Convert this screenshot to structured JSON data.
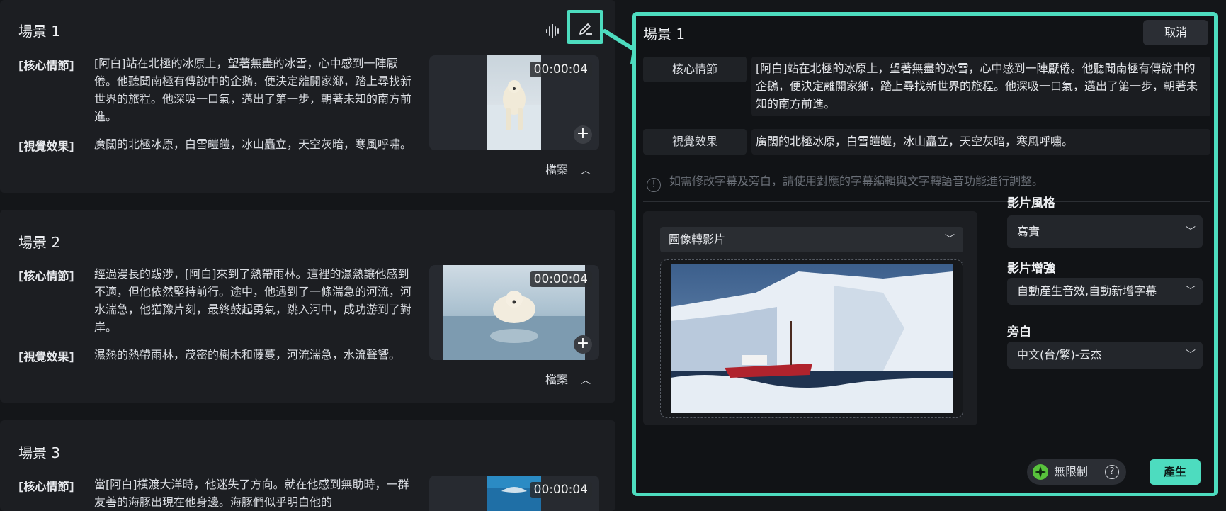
{
  "scenes": [
    {
      "title": "場景 1",
      "core_label": "[核心情節]",
      "core_text": "[阿白]站在北極的冰原上，望著無盡的冰雪，心中感到一陣厭倦。他聽聞南極有傳說中的企鵝，便決定離開家鄉，踏上尋找新世界的旅程。他深吸一口氣，邁出了第一步，朝著未知的南方前進。",
      "visual_label": "[視覺效果]",
      "visual_text": "廣闊的北極冰原，白雪皚皚，冰山矗立，天空灰暗，寒風呼嘯。",
      "timestamp": "00:00:04",
      "file_label": "檔案"
    },
    {
      "title": "場景 2",
      "core_label": "[核心情節]",
      "core_text": "經過漫長的跋涉，[阿白]來到了熱帶雨林。這裡的濕熱讓他感到不適，但他依然堅持前行。途中，他遇到了一條湍急的河流，河水湍急，他猶豫片刻，最終鼓起勇氣，跳入河中，成功游到了對岸。",
      "visual_label": "[視覺效果]",
      "visual_text": "濕熱的熱帶雨林，茂密的樹木和藤蔓，河流湍急，水流聲響。",
      "timestamp": "00:00:04",
      "file_label": "檔案"
    },
    {
      "title": "場景 3",
      "core_label": "[核心情節]",
      "core_text": "當[阿白]橫渡大洋時，他迷失了方向。就在他感到無助時，一群友善的海豚出現在他身邊。海豚們似乎明白他的",
      "timestamp": "00:00:04"
    }
  ],
  "icons": {
    "waveform": "waveform-icon",
    "edit": "edit-pencil-icon",
    "add": "plus-icon",
    "collapse": "chevron-up-icon",
    "expand": "chevron-down-icon",
    "info": "info-icon",
    "credit": "sparkle-gem-icon",
    "help": "question-icon"
  },
  "editor": {
    "title": "場景 1",
    "cancel_label": "取消",
    "core_label": "核心情節",
    "core_value": "[阿白]站在北極的冰原上，望著無盡的冰雪，心中感到一陣厭倦。他聽聞南極有傳說中的企鵝，便決定離開家鄉，踏上尋找新世界的旅程。他深吸一口氣，邁出了第一步，朝著未知的南方前進。",
    "visual_label": "視覺效果",
    "visual_value": "廣闊的北極冰原，白雪皚皚，冰山矗立，天空灰暗，寒風呼嘯。",
    "hint": "如需修改字幕及旁白，請使用對應的字幕編輯與文字轉語音功能進行調整。",
    "mode_selected": "圖像轉影片",
    "style_label": "影片風格",
    "style_value": "寫實",
    "enhance_label": "影片增強",
    "enhance_value": "自動產生音效,自動新增字幕",
    "narration_label": "旁白",
    "narration_value": "中文(台/繁)-云杰",
    "credit_label": "無限制",
    "generate_label": "產生"
  },
  "colors": {
    "accent": "#4ddcbf",
    "background": "#141619",
    "card": "#1c1e22"
  }
}
